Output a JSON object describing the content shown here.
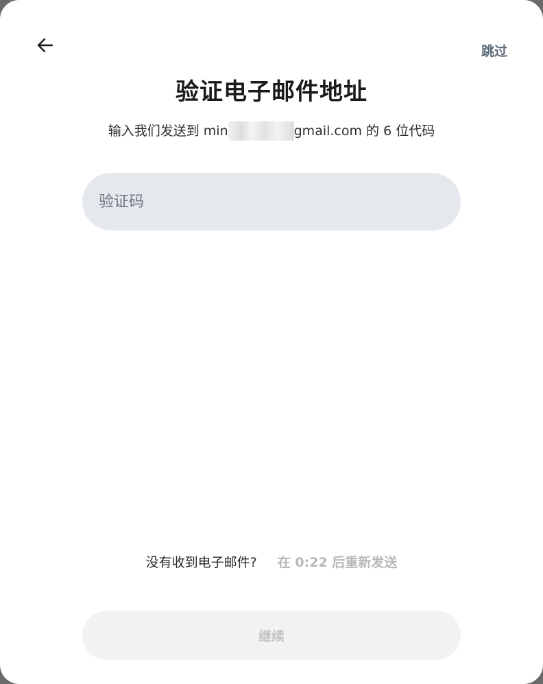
{
  "header": {
    "back_icon": "arrow-left-icon",
    "skip_label": "跳过"
  },
  "main": {
    "title": "验证电子邮件地址",
    "subtitle_prefix": "输入我们发送到 min",
    "subtitle_suffix": "gmail.com 的 6 位代码",
    "code_placeholder": "验证码",
    "code_value": ""
  },
  "resend": {
    "question": "没有收到电子邮件?",
    "timer_text": "在 0:22 后重新发送"
  },
  "footer": {
    "continue_label": "继续"
  },
  "colors": {
    "input_bg": "#e5e9ed",
    "button_disabled_bg": "#f2f2f2",
    "button_disabled_text": "#c2c2c2",
    "skip_text": "#5f6b78"
  }
}
